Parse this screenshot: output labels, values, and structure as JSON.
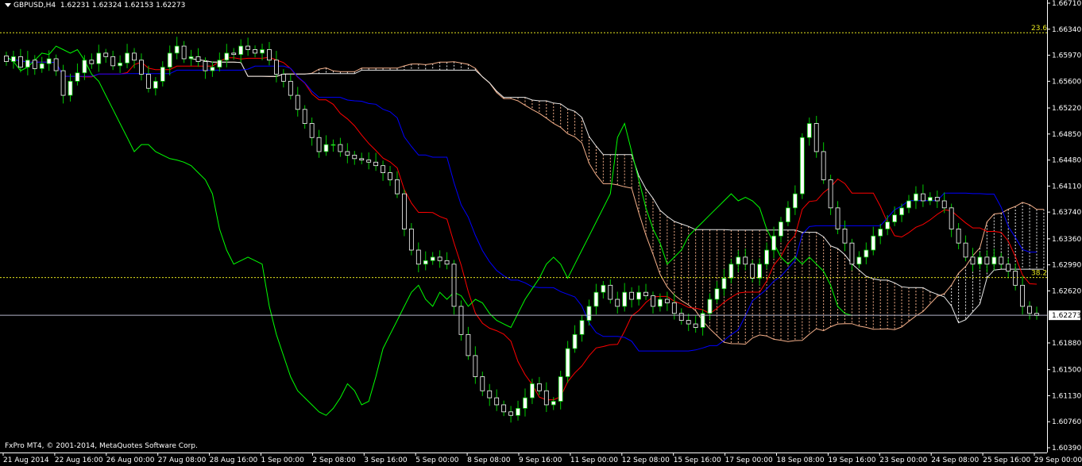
{
  "header": {
    "symbol": "GBPUSD,H4",
    "ohlc": "1.62231 1.62324 1.62153 1.62273"
  },
  "footer": {
    "copyright": "FxPro MT4, © 2001-2014, MetaQuotes Software Corp."
  },
  "colors": {
    "background": "#000000",
    "bull_candle": "#ffffff",
    "bear_candle": "#ffffff",
    "candle_outline": "#00c800",
    "tenkan": "#ff0000",
    "kijun": "#0000ff",
    "chikou": "#00ff00",
    "kumo_up": "#e8e8e8",
    "kumo_down": "#f5b08a",
    "fib_line": "#e6e61e",
    "price_line": "#b4b4c8"
  },
  "chart_data": {
    "type": "candlestick",
    "ylim": [
      1.6039,
      1.6671
    ],
    "y_ticks": [
      "1.66710",
      "1.66340",
      "1.65970",
      "1.65600",
      "1.65220",
      "1.64850",
      "1.64480",
      "1.64110",
      "1.63740",
      "1.63360",
      "1.62990",
      "1.62620",
      "1.62273",
      "1.61880",
      "1.61500",
      "1.61130",
      "1.60760",
      "1.60390"
    ],
    "x_ticks": [
      "21 Aug 2014",
      "22 Aug 16:00",
      "26 Aug 00:00",
      "27 Aug 08:00",
      "28 Aug 16:00",
      "1 Sep 00:00",
      "2 Sep 08:00",
      "3 Sep 16:00",
      "5 Sep 00:00",
      "8 Sep 08:00",
      "9 Sep 16:00",
      "11 Sep 00:00",
      "12 Sep 08:00",
      "15 Sep 16:00",
      "17 Sep 00:00",
      "18 Sep 08:00",
      "19 Sep 16:00",
      "23 Sep 00:00",
      "24 Sep 08:00",
      "25 Sep 16:00",
      "29 Sep 00:00"
    ],
    "current_price": "1.62273",
    "fib_levels": [
      {
        "label": "23.6",
        "value": 1.6629
      },
      {
        "label": "38.2",
        "value": 1.6281
      }
    ],
    "candle_closes": [
      1.6588,
      1.6595,
      1.658,
      1.659,
      1.6578,
      1.6585,
      1.6592,
      1.6575,
      1.654,
      1.656,
      1.6572,
      1.659,
      1.6585,
      1.66,
      1.6595,
      1.6582,
      1.6586,
      1.66,
      1.659,
      1.657,
      1.655,
      1.656,
      1.658,
      1.66,
      1.661,
      1.6592,
      1.6595,
      1.6588,
      1.6575,
      1.658,
      1.659,
      1.66,
      1.6598,
      1.661,
      1.6605,
      1.66,
      1.6605,
      1.659,
      1.657,
      1.656,
      1.654,
      1.652,
      1.65,
      1.648,
      1.646,
      1.647,
      1.647,
      1.646,
      1.6455,
      1.645,
      1.6448,
      1.6445,
      1.644,
      1.643,
      1.642,
      1.64,
      1.635,
      1.632,
      1.63,
      1.6305,
      1.631,
      1.6305,
      1.63,
      1.624,
      1.62,
      1.617,
      1.614,
      1.612,
      1.611,
      1.61,
      1.609,
      1.6085,
      1.6095,
      1.611,
      1.613,
      1.612,
      1.61,
      1.6105,
      1.614,
      1.618,
      1.62,
      1.622,
      1.624,
      1.626,
      1.627,
      1.625,
      1.624,
      1.626,
      1.625,
      1.626,
      1.6255,
      1.624,
      1.625,
      1.6245,
      1.623,
      1.622,
      1.6215,
      1.621,
      1.623,
      1.625,
      1.6265,
      1.628,
      1.63,
      1.631,
      1.63,
      1.628,
      1.63,
      1.632,
      1.634,
      1.636,
      1.638,
      1.64,
      1.648,
      1.65,
      1.646,
      1.642,
      1.638,
      1.635,
      1.633,
      1.63,
      1.631,
      1.632,
      1.634,
      1.635,
      1.636,
      1.637,
      1.638,
      1.639,
      1.64,
      1.639,
      1.6395,
      1.639,
      1.638,
      1.635,
      1.633,
      1.631,
      1.63,
      1.631,
      1.63,
      1.631,
      1.63,
      1.629,
      1.627,
      1.624,
      1.623,
      1.6227
    ]
  }
}
